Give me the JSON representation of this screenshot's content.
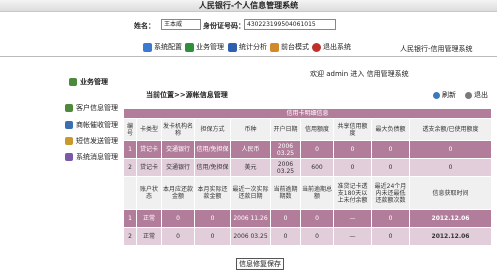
{
  "app_title": "人民银行-个人信息管理系统",
  "form": {
    "name_label": "姓名：",
    "name_value": "王本威",
    "id_label": "身份证号码：",
    "id_value": "430223199504061015"
  },
  "toolbar": {
    "items": [
      {
        "label": "系统配置",
        "icon": "gear-icon",
        "color": "#3b7ad0"
      },
      {
        "label": "业务管理",
        "icon": "briefcase-icon",
        "color": "#2f8f3a"
      },
      {
        "label": "统计分析",
        "icon": "chart-icon",
        "color": "#2f60b0"
      },
      {
        "label": "前台模式",
        "icon": "monitor-icon",
        "color": "#d08a2a"
      },
      {
        "label": "退出系统",
        "icon": "power-icon",
        "color": "#c0302a"
      }
    ],
    "system_name": "人民银行-信用管理系统"
  },
  "welcome": {
    "text": "欢迎 admin 进入 信用管理系统"
  },
  "sidebar": {
    "title": "业务管理",
    "items": [
      "客户信息管理",
      "商帐催收管理",
      "短信发送管理",
      "系统消息管理"
    ]
  },
  "breadcrumb": "当前位置>>源帐信息管理",
  "actions": {
    "refresh": "刷新",
    "back": "退出"
  },
  "table": {
    "title": "信用卡明细信息",
    "header1": [
      "编号",
      "卡类型",
      "发卡机构名称",
      "担保方式",
      "币种",
      "开户日期",
      "信用额度",
      "共享信用额度",
      "最大负债额",
      "透支余额/已使用额度"
    ],
    "rows1": [
      [
        "1",
        "贷记卡",
        "交通银行",
        "信用/免担保",
        "人民币",
        "2006 03.25",
        "0",
        "0",
        "0",
        "0"
      ],
      [
        "2",
        "贷记卡",
        "交通银行",
        "信用/免担保",
        "美元",
        "2006 03.25",
        "600",
        "0",
        "0",
        "0"
      ]
    ],
    "header2": [
      "",
      "账户状态",
      "本月应还款金额",
      "本月实际还款金额",
      "最近一次实际还款日期",
      "当前逾期期数",
      "当前逾期总额",
      "准贷记卡透支180天以上未付余额",
      "最近24个月内未还最低还款额次数",
      "信息获取时间"
    ],
    "rows2": [
      [
        "1",
        "正常",
        "0",
        "0",
        "2006 11.26",
        "0",
        "0",
        "—",
        "0",
        "2012.12.06"
      ],
      [
        "2",
        "正常",
        "0",
        "0",
        "2006 03.25",
        "0",
        "0",
        "—",
        "0",
        "2012.12.06"
      ]
    ]
  },
  "save_button": "信息修复保存"
}
